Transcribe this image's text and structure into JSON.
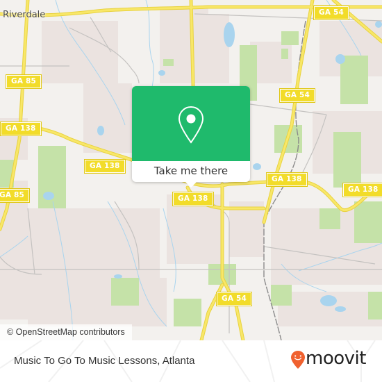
{
  "map": {
    "place_labels": [
      {
        "name": "Riverdale"
      }
    ],
    "road_shields": [
      {
        "label": "GA 54"
      },
      {
        "label": "GA 85"
      },
      {
        "label": "GA 54"
      },
      {
        "label": "GA 138"
      },
      {
        "label": "GA 138"
      },
      {
        "label": "GA 138"
      },
      {
        "label": "GA 138"
      },
      {
        "label": "GA 85"
      },
      {
        "label": "GA 138"
      },
      {
        "label": "GA 54"
      }
    ],
    "attribution": "© OpenStreetMap contributors",
    "colors": {
      "land": "#f3f1ee",
      "residential": "#ebe3e0",
      "park": "#c5e2a8",
      "water": "#a9d4ee",
      "highway": "#f6e35a",
      "road": "#bdbdbd"
    }
  },
  "popup": {
    "icon": "location-pin-icon",
    "action_label": "Take me there",
    "accent_color": "#1fba6c"
  },
  "footer": {
    "title": "Music To Go To Music Lessons, Atlanta",
    "brand": {
      "name": "moovit",
      "icon": "moovit-smiley-pin-icon",
      "color": "#f0612f"
    }
  }
}
